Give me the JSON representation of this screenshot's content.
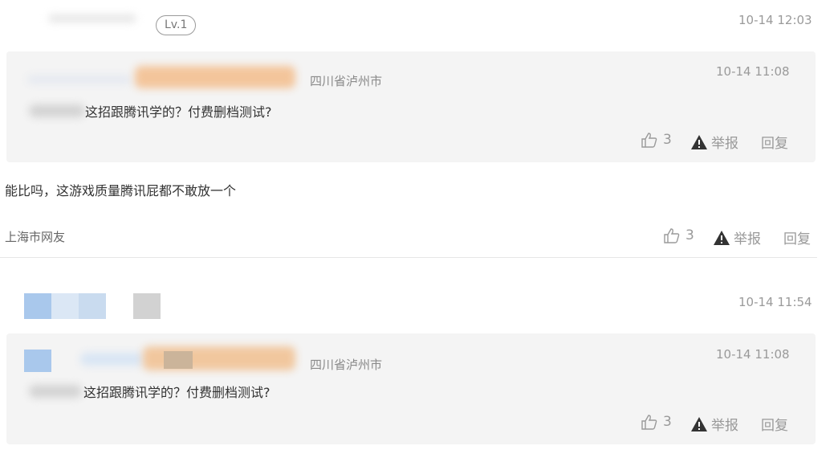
{
  "comment1": {
    "level_badge": "Lv.1",
    "time": "10-14 12:03",
    "quote": {
      "location": "四川省泸州市",
      "time": "10-14 11:08",
      "text": "这招跟腾讯学的？付费删档测试?",
      "likes": "3",
      "report_label": "举报",
      "reply_label": "回复"
    },
    "body_text": "能比吗，这游戏质量腾讯屁都不敢放一个",
    "location": "上海市网友",
    "likes": "3",
    "report_label": "举报",
    "reply_label": "回复"
  },
  "comment2": {
    "time": "10-14 11:54",
    "quote": {
      "location": "四川省泸州市",
      "time": "10-14 11:08",
      "text": "这招跟腾讯学的？付费删档测试?",
      "likes": "3",
      "report_label": "举报",
      "reply_label": "回复"
    }
  },
  "colors": {
    "quote_bg": "#f4f4f4",
    "blur_orange": "#f5c9a0",
    "blur_blue": "#b9d3ef",
    "text_gray": "#999999"
  },
  "icons": [
    "thumbs-up-icon",
    "warning-icon"
  ]
}
